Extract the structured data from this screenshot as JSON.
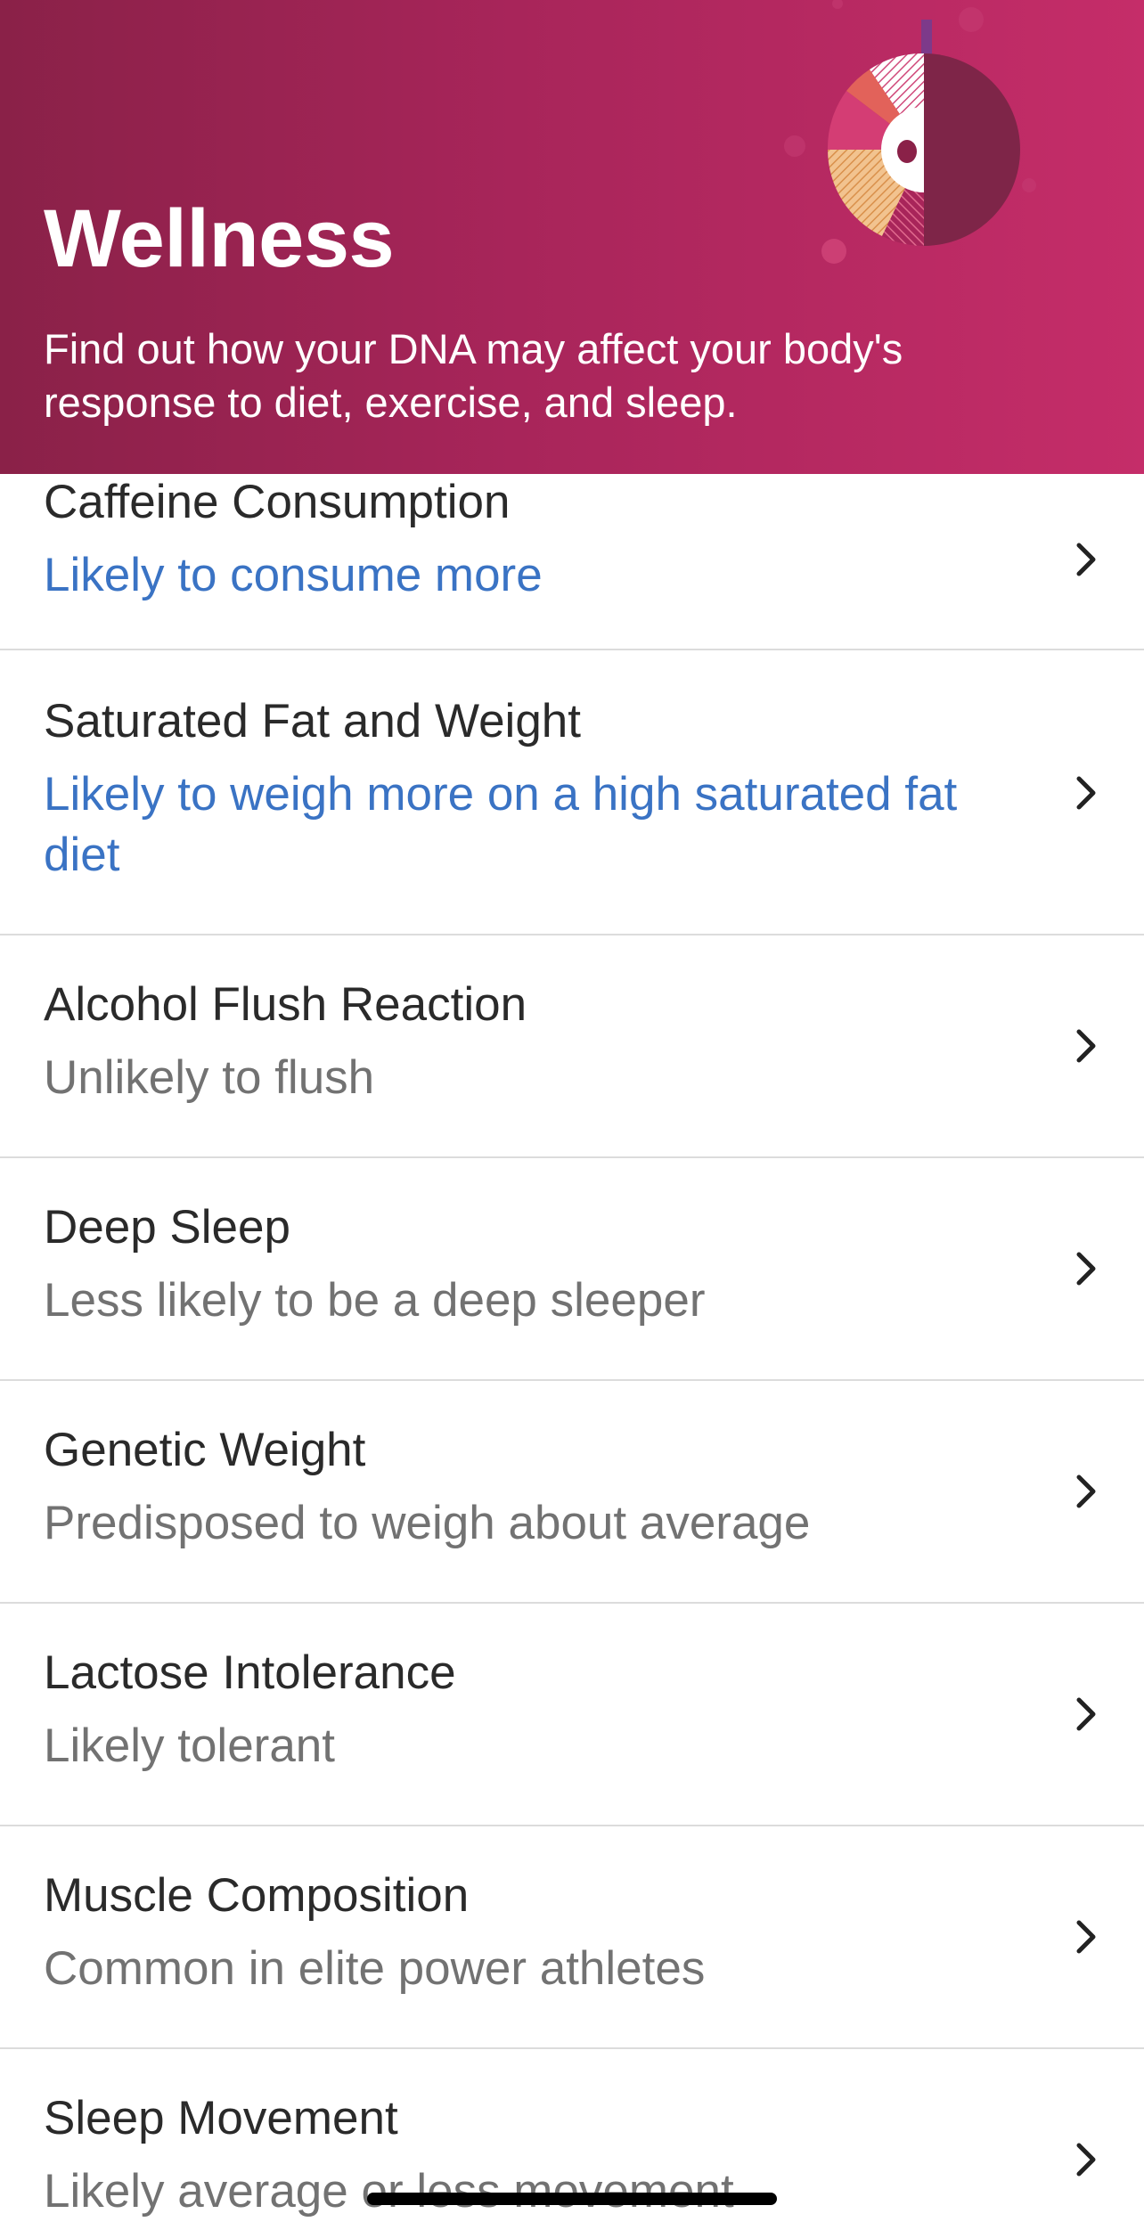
{
  "header": {
    "title": "Wellness",
    "subtitle": "Find out how your DNA may affect your body's response to diet, exercise, and sleep.",
    "colors": {
      "gradient_start": "#8a2148",
      "gradient_end": "#c52d69"
    },
    "illustration": "dna-wellness-pie-illustration"
  },
  "reports": [
    {
      "title": "Caffeine Consumption",
      "result": "Likely to consume more",
      "highlight": true
    },
    {
      "title": "Saturated Fat and Weight",
      "result": "Likely to weigh more on a high saturated fat diet",
      "highlight": true
    },
    {
      "title": "Alcohol Flush Reaction",
      "result": "Unlikely to flush",
      "highlight": false
    },
    {
      "title": "Deep Sleep",
      "result": "Less likely to be a deep sleeper",
      "highlight": false
    },
    {
      "title": "Genetic Weight",
      "result": "Predisposed to weigh about average",
      "highlight": false
    },
    {
      "title": "Lactose Intolerance",
      "result": "Likely tolerant",
      "highlight": false
    },
    {
      "title": "Muscle Composition",
      "result": "Common in elite power athletes",
      "highlight": false
    },
    {
      "title": "Sleep Movement",
      "result": "Likely average or less movement",
      "highlight": false
    }
  ],
  "icons": {
    "row_chevron": "chevron-right-icon"
  },
  "colors": {
    "highlight_text": "#3a73c4",
    "muted_text": "#727272",
    "title_text": "#2a2a2a"
  }
}
